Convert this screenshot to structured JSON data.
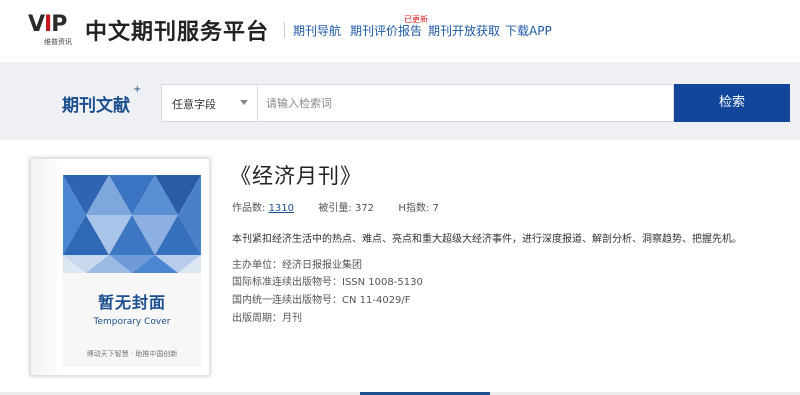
{
  "header": {
    "logo_text": "VIP",
    "logo_subtext": "维普资讯",
    "site_title": "中文期刊服务平台",
    "nav": [
      {
        "label": "期刊导航"
      },
      {
        "label": "期刊评价报告",
        "badge": "已更新"
      },
      {
        "label": "期刊开放获取"
      },
      {
        "label": "下载APP"
      }
    ]
  },
  "search": {
    "section_title": "期刊文献",
    "section_mark": "+",
    "field_selected": "任意字段",
    "placeholder": "请输入检索词",
    "button_label": "检索"
  },
  "cover": {
    "title": "暂无封面",
    "subtitle": "Temporary Cover",
    "slogan": "博动天下智慧 · 助推中国创新"
  },
  "journal": {
    "title": "《经济月刊》",
    "works_label": "作品数:",
    "works_value": "1310",
    "cited_label": "被引量:",
    "cited_value": "372",
    "h_label": "H指数:",
    "h_value": "7",
    "description": "本刊紧扣经济生活中的热点、难点、亮点和重大超级大经济事件，进行深度报道、解剖分析、洞察趋势、把握先机。",
    "sponsor": "主办单位：经济日报报业集团",
    "issn": "国际标准连续出版物号：ISSN 1008-5130",
    "cn": "国内统一连续出版物号：CN 11-4029/F",
    "cycle": "出版周期：月刊"
  },
  "colors": {
    "brand_blue": "#12469a",
    "link_blue": "#1d5aa8",
    "badge_red": "#e02020"
  }
}
